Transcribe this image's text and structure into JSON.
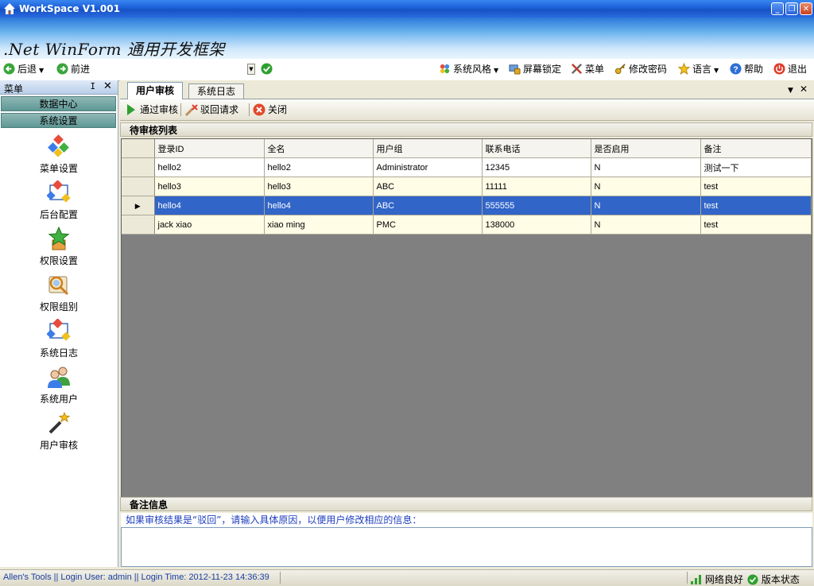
{
  "window": {
    "title": "WorkSpace  V1.001",
    "brand": ".Net WinForm 通用开发框架"
  },
  "toolbar": {
    "back": "后退",
    "forward": "前进",
    "style": "系统风格",
    "lock": "屏幕锁定",
    "menu": "菜单",
    "change_pwd": "修改密码",
    "language": "语言",
    "help": "帮助",
    "exit": "退出"
  },
  "sidebar": {
    "title": "菜单",
    "groups": [
      "数据中心",
      "系统设置"
    ],
    "items": [
      {
        "label": "菜单设置",
        "icon": "menu-settings-icon"
      },
      {
        "label": "后台配置",
        "icon": "backend-config-icon"
      },
      {
        "label": "权限设置",
        "icon": "permission-star-icon"
      },
      {
        "label": "权限组别",
        "icon": "permission-group-icon"
      },
      {
        "label": "系统日志",
        "icon": "system-log-icon"
      },
      {
        "label": "系统用户",
        "icon": "users-icon"
      },
      {
        "label": "用户审核",
        "icon": "magic-wand-icon"
      }
    ]
  },
  "tabs": [
    {
      "label": "用户审核",
      "active": true
    },
    {
      "label": "系统日志",
      "active": false
    }
  ],
  "commands": {
    "approve": "通过审核",
    "reject": "驳回请求",
    "close": "关闭"
  },
  "pending": {
    "title": "待审核列表",
    "columns": [
      "登录ID",
      "全名",
      "用户组",
      "联系电话",
      "是否启用",
      "备注"
    ],
    "rows": [
      {
        "id": "hello2",
        "name": "hello2",
        "group": "Administrator",
        "phone": "12345",
        "enabled": "N",
        "note": "测试一下",
        "selected": false
      },
      {
        "id": "hello3",
        "name": "hello3",
        "group": "ABC",
        "phone": "11111",
        "enabled": "N",
        "note": "test",
        "selected": false
      },
      {
        "id": "hello4",
        "name": "hello4",
        "group": "ABC",
        "phone": "555555",
        "enabled": "N",
        "note": "test",
        "selected": true
      },
      {
        "id": "jack xiao",
        "name": "xiao ming",
        "group": "PMC",
        "phone": "138000",
        "enabled": "N",
        "note": "test",
        "selected": false
      }
    ]
  },
  "remarks": {
    "title": "备注信息",
    "message": "如果审核结果是“驳回”，请输入具体原因，以便用户修改相应的信息：",
    "value": ""
  },
  "status": {
    "left": "Allen's Tools  ||  Login User: admin  ||  Login Time: 2012-11-23 14:36:39",
    "network": "网络良好",
    "version": "版本状态"
  }
}
